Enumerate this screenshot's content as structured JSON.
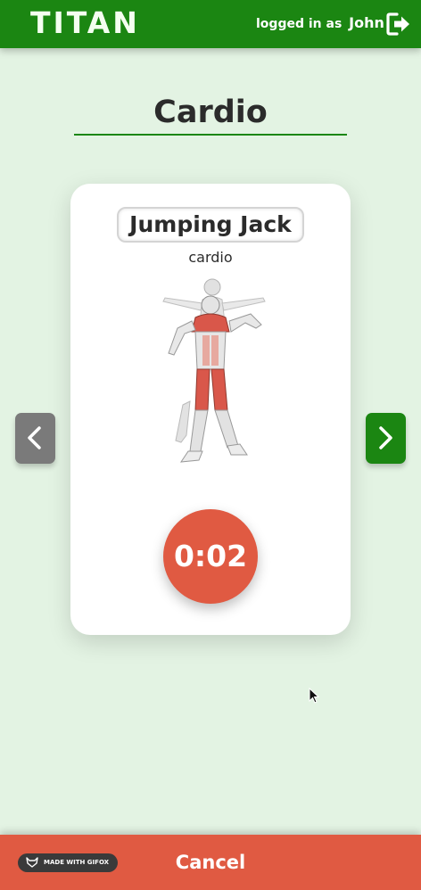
{
  "header": {
    "logo": "TITAN",
    "logged_in_prefix": "logged in as",
    "username": "John",
    "logout_icon": "logout-icon"
  },
  "page": {
    "title": "Cardio"
  },
  "exercise": {
    "name": "Jumping Jack",
    "category": "cardio",
    "timer": "0:02",
    "illustration_icon": "muscle-figure-icon"
  },
  "navigation": {
    "prev_icon": "chevron-left-icon",
    "next_icon": "chevron-right-icon"
  },
  "footer": {
    "cancel_label": "Cancel",
    "watermark": "MADE WITH GIFOX"
  },
  "colors": {
    "background": "#e3f3e3",
    "brand_green": "#1b8612",
    "accent_red": "#e05a42",
    "prev_button": "#7a7a7a"
  }
}
